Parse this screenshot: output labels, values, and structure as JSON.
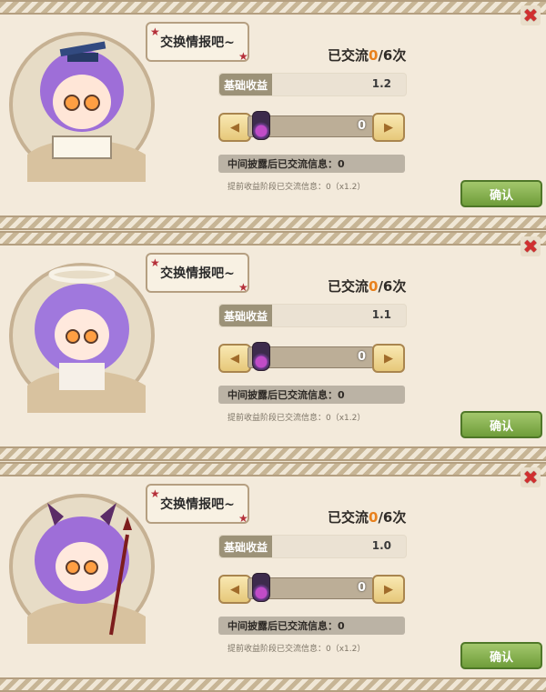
{
  "panels": [
    {
      "bubble_text": "交换情报吧~",
      "exchanged_prefix": "已交流",
      "exchanged_count": "0",
      "exchanged_suffix": "/6次",
      "base_income_label": "基础收益",
      "base_income_value": "1.2",
      "stepper_value": "0",
      "reveal_text": "中间披露后已交流信息：0",
      "early_text": "提前收益阶段已交流信息：0（x1.2）",
      "confirm_label": "确认",
      "character": "scholar-girl-with-glasses"
    },
    {
      "bubble_text": "交换情报吧~",
      "exchanged_prefix": "已交流",
      "exchanged_count": "0",
      "exchanged_suffix": "/6次",
      "base_income_label": "基础收益",
      "base_income_value": "1.1",
      "stepper_value": "0",
      "reveal_text": "中间披露后已交流信息：0",
      "early_text": "提前收益阶段已交流信息：0（x1.2）",
      "confirm_label": "确认",
      "character": "angel-girl-with-halo"
    },
    {
      "bubble_text": "交换情报吧~",
      "exchanged_prefix": "已交流",
      "exchanged_count": "0",
      "exchanged_suffix": "/6次",
      "base_income_label": "基础收益",
      "base_income_value": "1.0",
      "stepper_value": "0",
      "reveal_text": "中间披露后已交流信息：0",
      "early_text": "提前收益阶段已交流信息：0（x1.2）",
      "confirm_label": "确认",
      "character": "devil-girl-with-trident"
    }
  ],
  "icons": {
    "close": "close-icon",
    "left_arrow": "chevron-left-icon",
    "right_arrow": "chevron-right-icon",
    "bottle": "potion-bottle-icon"
  },
  "colors": {
    "highlight": "#e8811d",
    "confirm": "#7ea94a",
    "close": "#d12f2f"
  }
}
